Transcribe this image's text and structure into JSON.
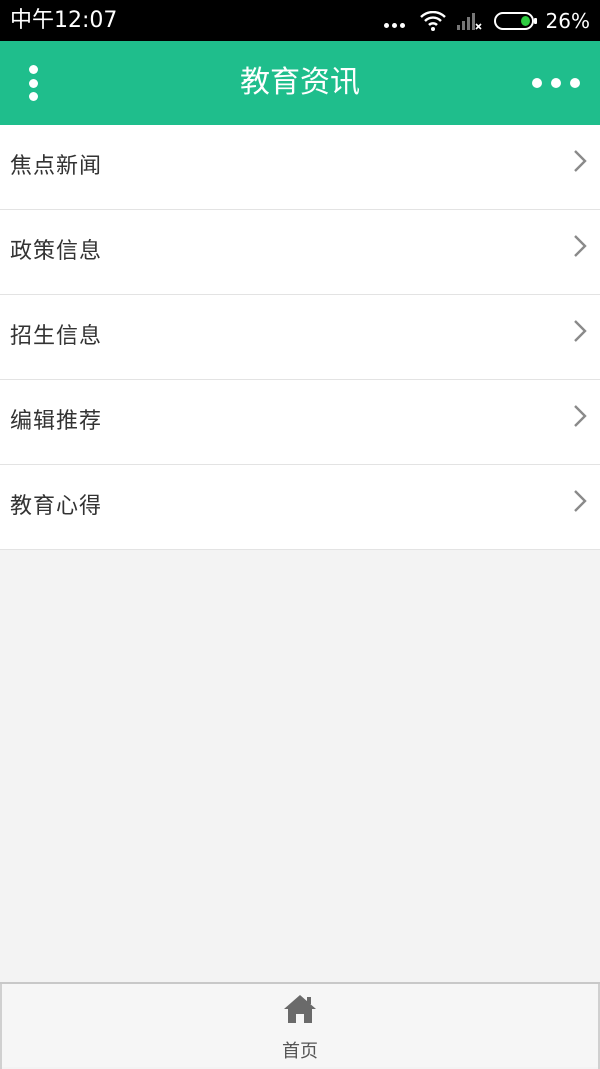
{
  "status_bar": {
    "time": "中午12:07",
    "battery": "26%"
  },
  "header": {
    "title": "教育资讯"
  },
  "list": {
    "items": [
      {
        "label": "焦点新闻"
      },
      {
        "label": "政策信息"
      },
      {
        "label": "招生信息"
      },
      {
        "label": "编辑推荐"
      },
      {
        "label": "教育心得"
      }
    ]
  },
  "tab_bar": {
    "home_label": "首页"
  },
  "colors": {
    "accent": "#1fbe8c",
    "background": "#f3f3f3"
  }
}
